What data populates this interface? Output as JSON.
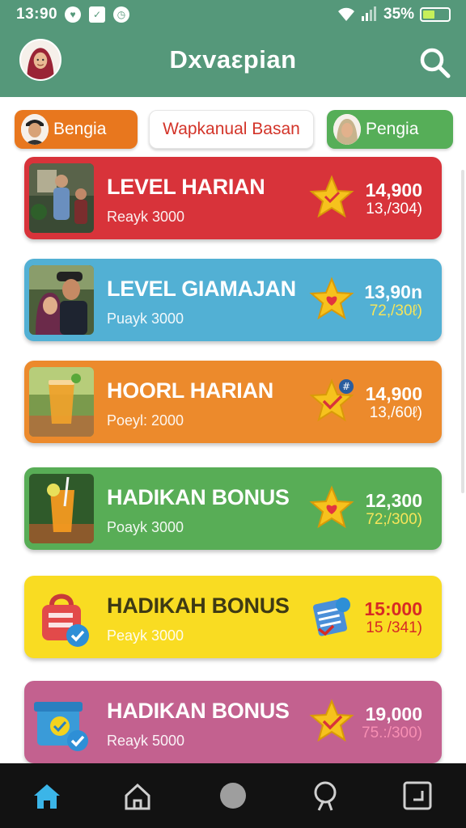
{
  "status_bar": {
    "time": "13:90",
    "battery_percent": "35%",
    "battery_level": 0.45,
    "icons": [
      "heart-icon",
      "calendar-icon",
      "alarm-icon",
      "wifi-icon",
      "signal-icon",
      "battery-icon"
    ]
  },
  "header": {
    "title": "Dxvaεpian",
    "avatar_icon": "user-avatar",
    "search_icon": "search-icon",
    "colors": {
      "background": "#55987a"
    }
  },
  "tabs": [
    {
      "label": "Bengia",
      "color": "#e8771e",
      "avatar": "boy-avatar"
    },
    {
      "label": "Wapkanual Basan",
      "color": "#ffffff",
      "text_color": "#d33429"
    },
    {
      "label": "Pengia",
      "color": "#56ae58",
      "avatar": "girl-avatar"
    }
  ],
  "cards": [
    {
      "title": "LEVEL HARIAN",
      "subtitle": "Reayk 3000",
      "value": "14,900",
      "ratio": "13,/304)",
      "color": "#d8333a",
      "icon": "star-icon",
      "thumb": "family-photo"
    },
    {
      "title": "LEVEL GIAMAJAN",
      "subtitle": "Puayk 3000",
      "value": "13,90n",
      "ratio": "72,/30ℓ)",
      "color": "#52b0d4",
      "icon": "star-heart-icon",
      "thumb": "couple-photo"
    },
    {
      "title": "HOORL HARIAN",
      "subtitle": "Poeyl: 2000",
      "value": "14,900",
      "ratio": "13,/60ℓ)",
      "color": "#ec8a2c",
      "icon": "star-check-icon",
      "thumb": "iced-tea-photo"
    },
    {
      "title": "HADIKAN BONUS",
      "subtitle": "Poayk 3000",
      "value": "12,300",
      "ratio": "72;/300)",
      "color": "#58ad56",
      "icon": "star-heart-icon",
      "thumb": "lemon-drink-photo"
    },
    {
      "title": "HADIKAH BONUS",
      "subtitle": "Peayk 3000",
      "value": "15:000",
      "ratio": "15 /341)",
      "color": "#f9dc22",
      "icon": "calendar-check-icon",
      "thumb": "lock-check-icon"
    },
    {
      "title": "HADIKAN BONUS",
      "subtitle": "Reayk 5000",
      "value": "19,000",
      "ratio": "75.:/300)",
      "color": "#c3618f",
      "icon": "star-check-icon",
      "thumb": "box-check-icon"
    }
  ],
  "bottom_nav": {
    "items": [
      "home-filled-icon",
      "home-outline-icon",
      "circle-icon",
      "search-icon",
      "square-icon"
    ],
    "active_color": "#3bb5e8"
  }
}
